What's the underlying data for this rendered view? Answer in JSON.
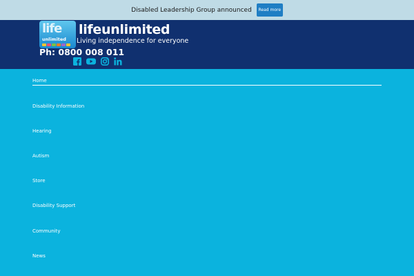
{
  "announcement": {
    "text": "Disabled Leadership Group announced",
    "button_label": "Read more"
  },
  "header": {
    "logo": {
      "tile_text_top": "life",
      "tile_text_bottom": "unlimited"
    },
    "brand_name": "lifeunlimited",
    "tagline": "Living independence for everyone",
    "phone": "Ph: 0800 008 011",
    "social_icons": [
      "facebook-icon",
      "youtube-icon",
      "instagram-icon",
      "linkedin-icon"
    ]
  },
  "colors": {
    "announcement_bg": "#bfdbe6",
    "button_bg": "#1f7ec4",
    "header_bg": "#10306f",
    "page_bg": "#0bb3de",
    "social_icon": "#0bb3de"
  },
  "nav": {
    "items": [
      {
        "label": "Home",
        "active": true
      },
      {
        "label": "Disability Information",
        "active": false
      },
      {
        "label": "Hearing",
        "active": false
      },
      {
        "label": "Autism",
        "active": false
      },
      {
        "label": "Store",
        "active": false
      },
      {
        "label": "Disability Support",
        "active": false
      },
      {
        "label": "Community",
        "active": false
      },
      {
        "label": "News",
        "active": false
      }
    ]
  }
}
